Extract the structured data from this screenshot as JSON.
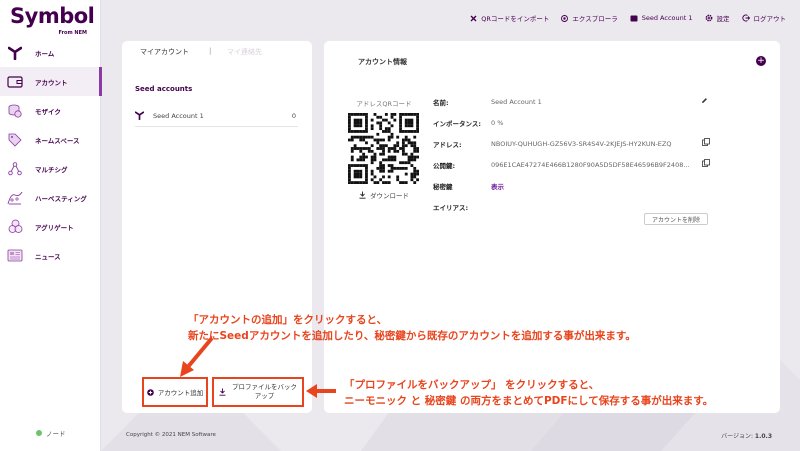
{
  "app": {
    "logo_text": "Symbol",
    "logo_sub": "From NEM"
  },
  "sidebar": {
    "items": [
      {
        "label": "ホーム",
        "icon": "symbol-logo-icon"
      },
      {
        "label": "アカウント",
        "icon": "wallet-icon",
        "active": true
      },
      {
        "label": "モザイク",
        "icon": "coins-icon"
      },
      {
        "label": "ネームスペース",
        "icon": "tag-icon"
      },
      {
        "label": "マルチシグ",
        "icon": "multisig-icon"
      },
      {
        "label": "ハーベスティング",
        "icon": "harvest-icon"
      },
      {
        "label": "アグリゲート",
        "icon": "aggregate-icon"
      },
      {
        "label": "ニュース",
        "icon": "news-icon"
      }
    ],
    "node_label": "ノード"
  },
  "topbar": {
    "qr_import": "QRコードをインポート",
    "explorer": "エクスプローラ",
    "account": "Seed Account 1",
    "settings": "設定",
    "logout": "ログアウト"
  },
  "left_panel": {
    "tab_my_accounts": "マイアカウント",
    "tab_other": "マイ連絡先",
    "section_title": "Seed accounts",
    "accounts": [
      {
        "name": "Seed Account 1",
        "count": "0"
      }
    ],
    "add_account_label": "アカウント追加",
    "backup_label_line1": "プロファイルをバック",
    "backup_label_line2": "アップ"
  },
  "right_panel": {
    "title": "アカウント情報",
    "qr_label": "アドレスQRコード",
    "download_label": "ダウンロード",
    "fields": {
      "name_label": "名前:",
      "name_value": "Seed Account 1",
      "importance_label": "インポータンス:",
      "importance_value": "0 %",
      "address_label": "アドレス:",
      "address_value": "NBOIUY-QUHUGH-GZ56V3-SR4S4V-2KJEJS-HY2KUN-EZQ",
      "pubkey_label": "公開鍵:",
      "pubkey_value": "096E1CAE47274E466B1280F90A5D5DF58E46596B9F2408...",
      "privkey_label": "秘密鍵",
      "privkey_link": "表示",
      "alias_label": "エイリアス:"
    },
    "delete_label": "アカウントを削除"
  },
  "annotations": {
    "top_line1": "「アカウントの追加」をクリックすると、",
    "top_line2": "新たにSeedアカウントを追加したり、秘密鍵から既存のアカウントを追加する事が出来ます。",
    "bottom_line1": "「プロファイルをバックアップ」 をクリックすると、",
    "bottom_line2": "ニーモニック と 秘密鍵 の両方をまとめてPDFにして保存する事が出来ます。"
  },
  "footer": {
    "copyright": "Copyright © 2021 NEM Software",
    "version_label": "バージョン: ",
    "version_value": "1.0.3"
  },
  "colors": {
    "brand": "#44004e",
    "accent": "#8a3ba3",
    "annotation": "#e8451e"
  }
}
